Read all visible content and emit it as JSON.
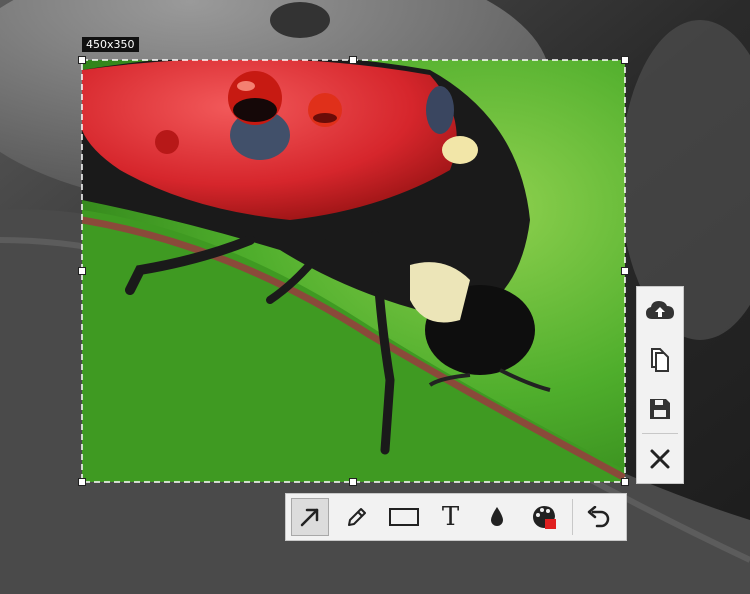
{
  "capture": {
    "size_label": "450x350"
  },
  "side_toolbar": {
    "items": [
      {
        "icon": "upload-cloud-icon"
      },
      {
        "icon": "copy-icon"
      },
      {
        "icon": "save-icon"
      },
      {
        "icon": "close-icon"
      }
    ]
  },
  "bottom_toolbar": {
    "active_tool": "arrow",
    "tools": [
      {
        "icon": "arrow-icon"
      },
      {
        "icon": "pencil-icon"
      },
      {
        "icon": "rectangle-icon"
      },
      {
        "icon": "text-icon",
        "glyph": "T"
      },
      {
        "icon": "blur-drop-icon"
      },
      {
        "icon": "color-palette-icon"
      },
      {
        "icon": "undo-icon"
      }
    ],
    "selected_color": "#e02020"
  }
}
